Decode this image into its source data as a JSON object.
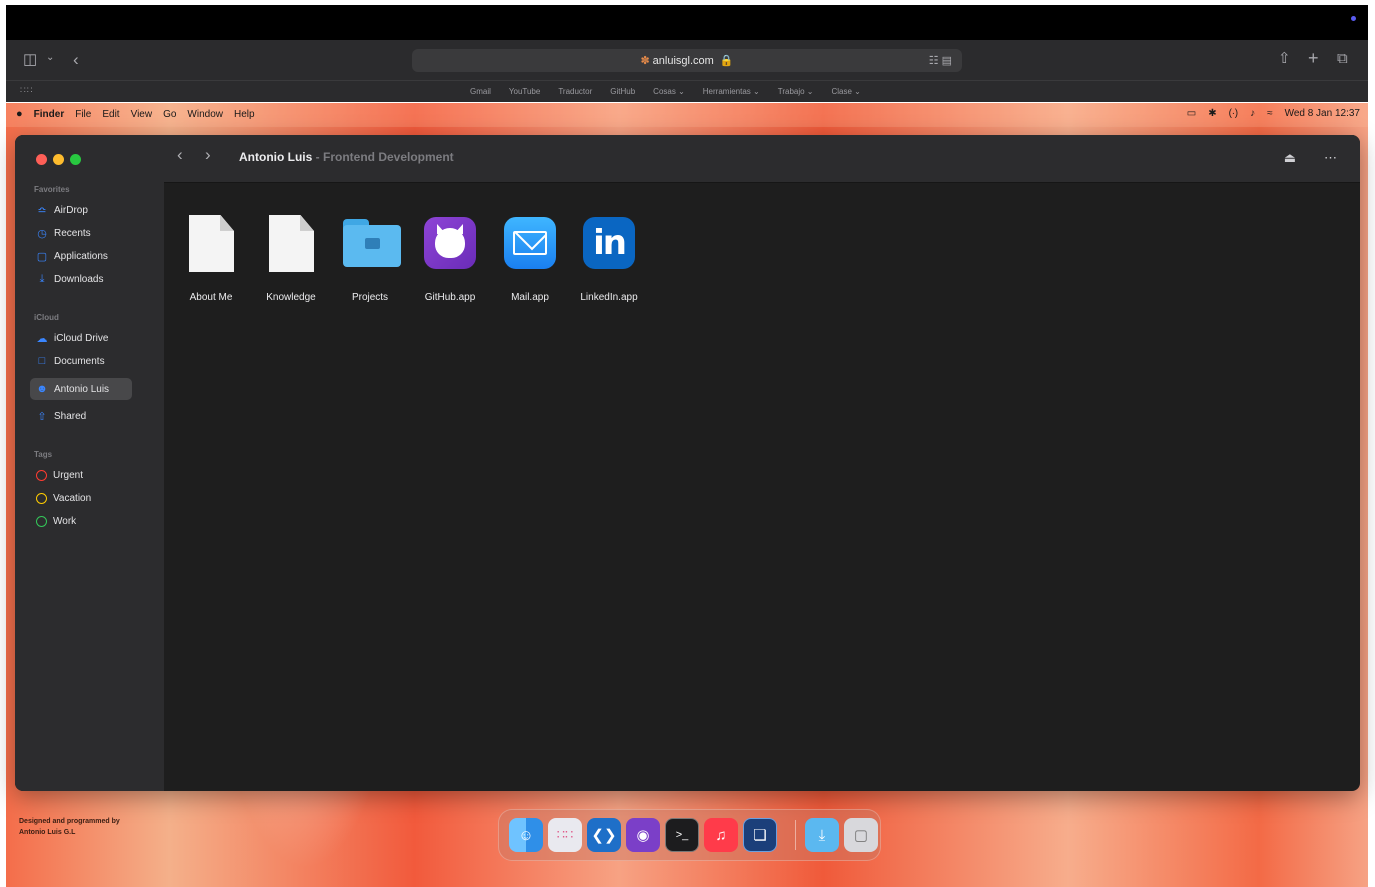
{
  "browser": {
    "url": "anluisgl.com",
    "bookmarks": [
      "Gmail",
      "YouTube",
      "Traductor",
      "GitHub",
      "Cosas ⌄",
      "Herramientas ⌄",
      "Trabajo ⌄",
      "Clase ⌄"
    ],
    "icons": [
      "sidebar-icon",
      "chevron-down-icon",
      "back-icon",
      "lock-icon",
      "translate-icon",
      "share-icon",
      "plus-icon",
      "tabs-icon",
      "grid-icon"
    ]
  },
  "menubar": {
    "apple": "",
    "app_name": "Finder",
    "menus": [
      "File",
      "Edit",
      "View",
      "Go",
      "Window",
      "Help"
    ],
    "clock": "Wed 8 Jan 12:37"
  },
  "finder": {
    "title": "Antonio Luis",
    "subtitle": "- Frontend Development",
    "sidebar": {
      "favorites_heading": "Favorites",
      "favorites": [
        {
          "label": "AirDrop",
          "icon": "airdrop-icon"
        },
        {
          "label": "Recents",
          "icon": "clock-icon"
        },
        {
          "label": "Applications",
          "icon": "applications-icon"
        },
        {
          "label": "Downloads",
          "icon": "download-icon"
        }
      ],
      "icloud_heading": "iCloud",
      "icloud": [
        {
          "label": "iCloud Drive",
          "icon": "cloud-icon"
        },
        {
          "label": "Documents",
          "icon": "document-icon"
        },
        {
          "label": "Antonio Luis",
          "icon": "person-icon",
          "active": true
        },
        {
          "label": "Shared",
          "icon": "share-icon"
        }
      ],
      "tags_heading": "Tags",
      "tags": [
        {
          "label": "Urgent",
          "color": "#ff3b30"
        },
        {
          "label": "Vacation",
          "color": "#ffcc00"
        },
        {
          "label": "Work",
          "color": "#34c759"
        }
      ]
    },
    "files": [
      {
        "label": "About Me",
        "icon": "document-icon"
      },
      {
        "label": "Knowledge",
        "icon": "document-icon"
      },
      {
        "label": "Projects",
        "icon": "folder-icon"
      },
      {
        "label": "GitHub.app",
        "icon": "github-icon"
      },
      {
        "label": "Mail.app",
        "icon": "mail-icon"
      },
      {
        "label": "LinkedIn.app",
        "icon": "linkedin-icon"
      }
    ]
  },
  "footer": {
    "credit_line1": "Designed and programmed by",
    "credit_line2": "Antonio Luis G.L"
  },
  "dock": {
    "apps": [
      "finder-icon",
      "launchpad-icon",
      "vscode-icon",
      "github-icon",
      "terminal-icon",
      "music-icon",
      "virtualbox-icon",
      "downloads-folder-icon",
      "trash-icon"
    ]
  }
}
